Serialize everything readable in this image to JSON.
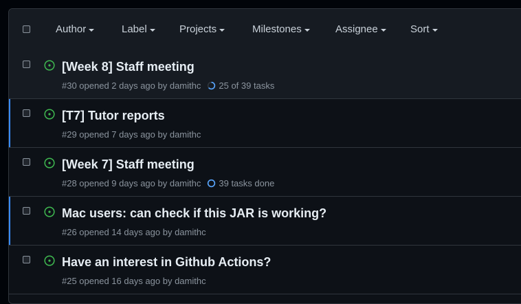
{
  "filters": {
    "author": "Author",
    "label": "Label",
    "projects": "Projects",
    "milestones": "Milestones",
    "assignee": "Assignee",
    "sort": "Sort"
  },
  "issues": [
    {
      "title": "[Week 8] Staff meeting",
      "meta": "#30 opened 2 days ago by damithc",
      "tasks": "25 of 39 tasks",
      "task_fraction": 0.64
    },
    {
      "title": "[T7] Tutor reports",
      "meta": "#29 opened 7 days ago by damithc"
    },
    {
      "title": "[Week 7] Staff meeting",
      "meta": "#28 opened 9 days ago by damithc",
      "tasks": "39 tasks done",
      "task_fraction": 1.0
    },
    {
      "title": "Mac users: can check if this JAR is working?",
      "meta": "#26 opened 14 days ago by damithc"
    },
    {
      "title": "Have an interest in Github Actions?",
      "meta": "#25 opened 16 days ago by damithc"
    }
  ],
  "colors": {
    "open_icon": "#3fb950",
    "progress": "#58a6ff",
    "unread_marker": "#388bfd"
  },
  "icons": {
    "open_issue": "issue-opened-icon",
    "progress": "progress-circle-icon",
    "dropdown": "caret-down-icon"
  }
}
